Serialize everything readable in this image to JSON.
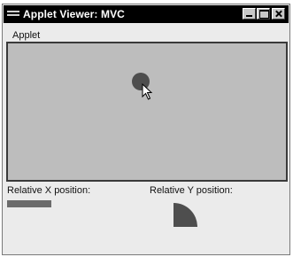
{
  "window": {
    "title": "Applet Viewer: MVC"
  },
  "menu": {
    "items": [
      "Applet"
    ]
  },
  "labels": {
    "relative_x": "Relative X position:",
    "relative_y": "Relative Y position:"
  },
  "icons": {
    "system_menu": "system-menu-icon",
    "minimize": "minimize-icon",
    "maximize": "maximize-icon",
    "close": "close-icon",
    "cursor": "pointer-cursor-icon"
  },
  "colors": {
    "titlebar": "#000000",
    "canvas": "#bdbdbd",
    "dot": "#4e4e4e",
    "indicator": "#4e4e4e"
  }
}
